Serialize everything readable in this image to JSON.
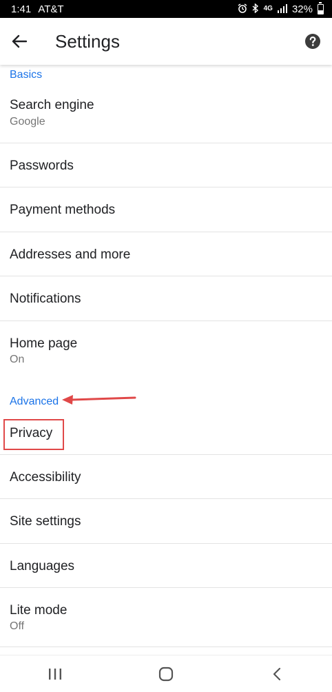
{
  "status_bar": {
    "time": "1:41",
    "carrier": "AT&T",
    "network": "4G",
    "battery": "32%",
    "icons": [
      "alarm-icon",
      "bluetooth-icon",
      "lte-icon",
      "signal-icon",
      "battery-icon"
    ]
  },
  "app_bar": {
    "title": "Settings",
    "back_icon": "back-arrow-icon",
    "help_icon": "help-icon"
  },
  "sections": {
    "basics": "Basics",
    "advanced": "Advanced"
  },
  "items": {
    "search_engine": {
      "label": "Search engine",
      "sub": "Google"
    },
    "passwords": {
      "label": "Passwords"
    },
    "payment_methods": {
      "label": "Payment methods"
    },
    "addresses": {
      "label": "Addresses and more"
    },
    "notifications": {
      "label": "Notifications"
    },
    "home_page": {
      "label": "Home page",
      "sub": "On"
    },
    "privacy": {
      "label": "Privacy"
    },
    "accessibility": {
      "label": "Accessibility"
    },
    "site_settings": {
      "label": "Site settings"
    },
    "languages": {
      "label": "Languages"
    },
    "lite_mode": {
      "label": "Lite mode",
      "sub": "Off"
    }
  },
  "annotations": {
    "highlight_color": "#e04848",
    "arrow_color": "#e04848"
  },
  "colors": {
    "accent": "#1a73e8",
    "text": "#202124",
    "subtext": "#757575",
    "divider": "#e3e3e3"
  },
  "nav_bar": {
    "icons": [
      "recents-icon",
      "home-icon",
      "back-icon"
    ]
  }
}
